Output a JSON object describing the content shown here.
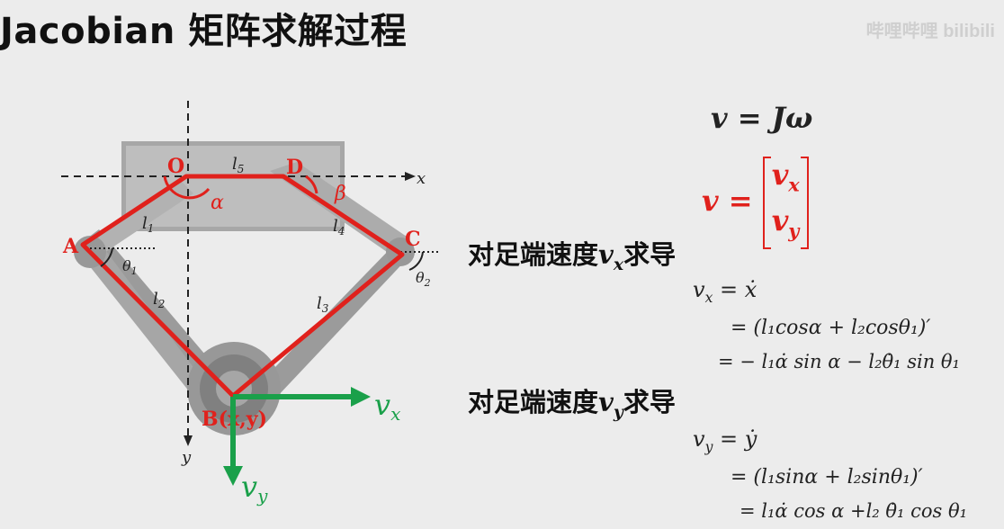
{
  "title": "Jacobian 矩阵求解过程",
  "watermark": "哔哩哔哩 bilibili",
  "diagram": {
    "points": {
      "O": "O",
      "D": "D",
      "A": "A",
      "C": "C",
      "B": "B(x,y)"
    },
    "links": {
      "l1": "l",
      "l1_sub": "1",
      "l2": "l",
      "l2_sub": "2",
      "l3": "l",
      "l3_sub": "3",
      "l4": "l",
      "l4_sub": "4",
      "l5": "l",
      "l5_sub": "5"
    },
    "angles": {
      "alpha": "α",
      "beta": "β",
      "theta1": "θ",
      "theta1_sub": "1",
      "theta2": "θ",
      "theta2_sub": "2"
    },
    "axes": {
      "x": "x",
      "y": "y"
    },
    "velocity": {
      "vx": "v",
      "vx_sub": "x",
      "vy": "v",
      "vy_sub": "y"
    },
    "colors": {
      "linkage": "#e0211c",
      "velocity": "#1aa04a",
      "frame": "#8a8a8a"
    }
  },
  "equations": {
    "eq1": "v = Jω",
    "eq2_lhs": "v =",
    "eq2_top": "v",
    "eq2_top_sub": "x",
    "eq2_bottom": "v",
    "eq2_bottom_sub": "y",
    "section1": {
      "heading": "对足端速度",
      "symbol": "v",
      "symbol_sub": "x",
      "suffix": "求导",
      "line1": "v",
      "line1_sub": "x",
      "line1_rhs": " = ẋ",
      "line2": "= (l₁cosα + l₂cosθ₁)′",
      "line3": "= − l₁α̇ sin α − l₂θ̇₁ sin θ₁"
    },
    "section2": {
      "heading": "对足端速度",
      "symbol": "v",
      "symbol_sub": "y",
      "suffix": "求导",
      "line1": "v",
      "line1_sub": "y",
      "line1_rhs": " = ẏ",
      "line2": "= (l₁sinα + l₂sinθ₁)′",
      "line3": "= l₁α̇ cos α +l₂ θ̇₁ cos θ₁"
    }
  }
}
